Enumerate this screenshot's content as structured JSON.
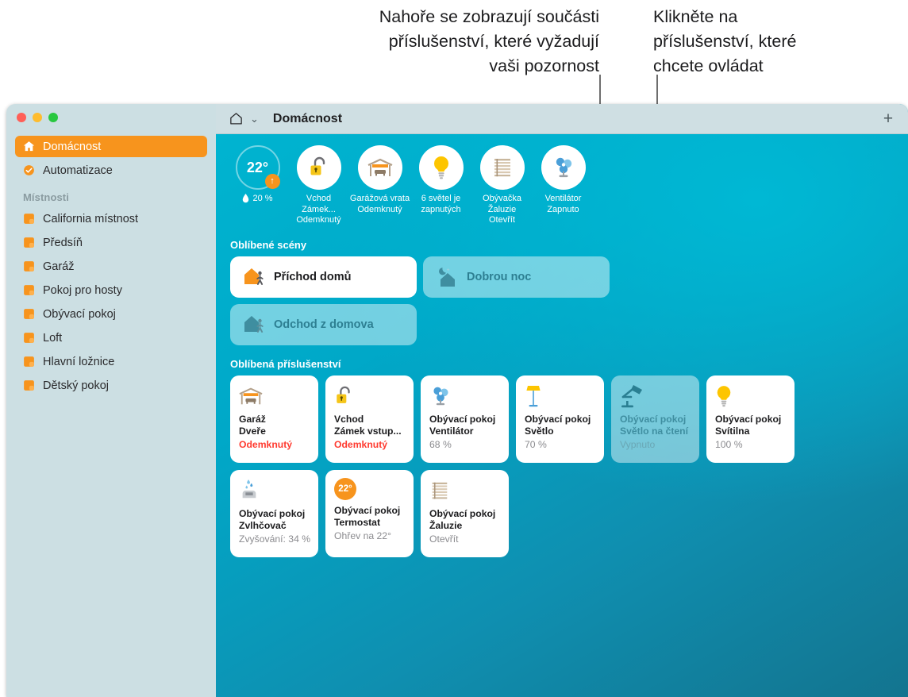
{
  "callouts": {
    "left": "Nahoře se zobrazují součásti\npříslušenství, které vyžadují\nvaši pozornost",
    "right": "Klikněte na\npříslušenství, které\nchcete ovládat"
  },
  "window": {
    "titlebar": {
      "title": "Domácnost",
      "home_icon": "house-icon",
      "chevron": "⌄",
      "add_label": "+"
    }
  },
  "sidebar": {
    "top_items": [
      {
        "label": "Domácnost",
        "icon": "house-icon",
        "selected": true
      },
      {
        "label": "Automatizace",
        "icon": "clock-check-icon",
        "selected": false
      }
    ],
    "rooms_header": "Místnosti",
    "rooms": [
      {
        "label": "California místnost",
        "icon": "room-icon"
      },
      {
        "label": "Předsíň",
        "icon": "room-icon"
      },
      {
        "label": "Garáž",
        "icon": "room-icon"
      },
      {
        "label": "Pokoj pro hosty",
        "icon": "room-icon"
      },
      {
        "label": "Obývací pokoj",
        "icon": "room-icon"
      },
      {
        "label": "Loft",
        "icon": "room-icon"
      },
      {
        "label": "Hlavní ložnice",
        "icon": "room-icon"
      },
      {
        "label": "Dětský pokoj",
        "icon": "room-icon"
      }
    ]
  },
  "status_row": {
    "temperature": {
      "value": "22°",
      "badge": "↑",
      "humidity": "20 %",
      "humidity_icon": "droplet-icon"
    },
    "items": [
      {
        "icon": "lock-open-icon",
        "label": "Vchod Zámek...\nOdemknutý"
      },
      {
        "icon": "garage-icon",
        "label": "Garážová vrata\nOdemknutý"
      },
      {
        "icon": "bulb-icon",
        "label": "6 světel je\nzapnutých"
      },
      {
        "icon": "blinds-icon",
        "label": "Obývačka Žaluzie\nOtevřít"
      },
      {
        "icon": "fan-icon",
        "label": "Ventilátor\nZapnuto"
      }
    ]
  },
  "scenes": {
    "title": "Oblíbené scény",
    "items": [
      {
        "label": "Příchod domů",
        "icon": "house-walk-icon",
        "state": "on"
      },
      {
        "label": "Dobrou noc",
        "icon": "moon-house-icon",
        "state": "off"
      },
      {
        "label": "Odchod z domova",
        "icon": "house-walk-icon",
        "state": "off"
      }
    ]
  },
  "accessories": {
    "title": "Oblíbená příslušenství",
    "items": [
      {
        "icon": "garage-icon",
        "name": "Garáž\nDveře",
        "state": "Odemknutý",
        "state_style": "alert",
        "card_state": "on"
      },
      {
        "icon": "lock-open-icon",
        "name": "Vchod\nZámek vstup...",
        "state": "Odemknutý",
        "state_style": "alert",
        "card_state": "on"
      },
      {
        "icon": "fan-icon",
        "name": "Obývací pokoj\nVentilátor",
        "state": "68 %",
        "state_style": "normal",
        "card_state": "on"
      },
      {
        "icon": "lamp-icon",
        "name": "Obývací pokoj\nSvětlo",
        "state": "70 %",
        "state_style": "normal",
        "card_state": "on"
      },
      {
        "icon": "desk-lamp-icon",
        "name": "Obývací pokoj\nSvětlo na čtení",
        "state": "Vypnuto",
        "state_style": "normal",
        "card_state": "off"
      },
      {
        "icon": "bulb-icon",
        "name": "Obývací pokoj\nSvítilna",
        "state": "100 %",
        "state_style": "normal",
        "card_state": "on"
      },
      {
        "icon": "humidifier-icon",
        "name": "Obývací pokoj\nZvlhčovač",
        "state": "Zvyšování: 34 %",
        "state_style": "normal",
        "card_state": "on"
      },
      {
        "icon": "thermostat-icon",
        "name": "Obývací pokoj\nTermostat",
        "state": "Ohřev na 22°",
        "state_style": "normal",
        "card_state": "on",
        "badge": "22°"
      },
      {
        "icon": "blinds-icon",
        "name": "Obývací pokoj\nŽaluzie",
        "state": "Otevřít",
        "state_style": "normal",
        "card_state": "on"
      }
    ]
  },
  "colors": {
    "accent_orange": "#f7941d",
    "alert_red": "#ff3b30",
    "sidebar_bg": "#ccdfe3",
    "main_teal": "#00b5d1"
  }
}
